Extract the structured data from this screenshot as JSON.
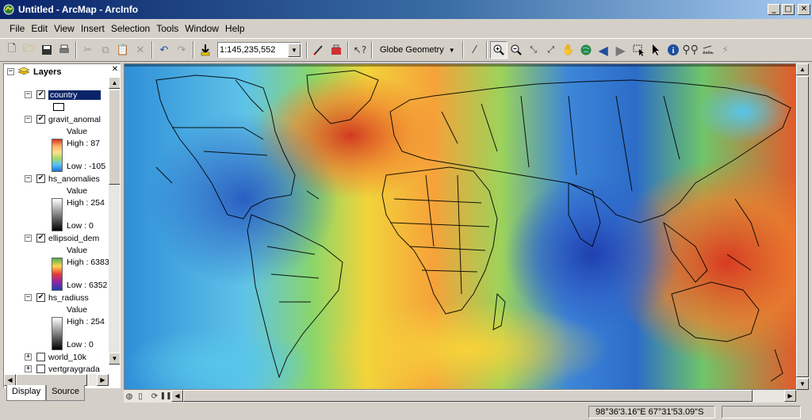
{
  "window": {
    "title": "Untitled - ArcMap - ArcInfo",
    "minimize": "_",
    "maximize": "□",
    "close": "✕"
  },
  "menu": [
    "File",
    "Edit",
    "View",
    "Insert",
    "Selection",
    "Tools",
    "Window",
    "Help"
  ],
  "toolbar": {
    "scale": "1:145,235,552",
    "globe_geometry": "Globe Geometry"
  },
  "toc": {
    "root": "Layers",
    "layers": [
      {
        "name": "country",
        "checked": true,
        "selected": true
      },
      {
        "name": "gravit_anomal",
        "checked": true,
        "value_label": "Value",
        "high": "High : 87",
        "low": "Low : -105"
      },
      {
        "name": "hs_anomalies",
        "checked": true,
        "value_label": "Value",
        "high": "High : 254",
        "low": "Low : 0"
      },
      {
        "name": "ellipsoid_dem",
        "checked": true,
        "value_label": "Value",
        "high": "High : 6383",
        "low": "Low : 6352"
      },
      {
        "name": "hs_radiuss",
        "checked": true,
        "value_label": "Value",
        "high": "High : 254",
        "low": "Low : 0"
      },
      {
        "name": "world_10k",
        "checked": false
      },
      {
        "name": "vertgraygrada",
        "checked": false
      }
    ],
    "tabs": [
      "Display",
      "Source"
    ]
  },
  "status": {
    "coords": "98°36'3.16\"E  67°31'53.09\"S"
  }
}
